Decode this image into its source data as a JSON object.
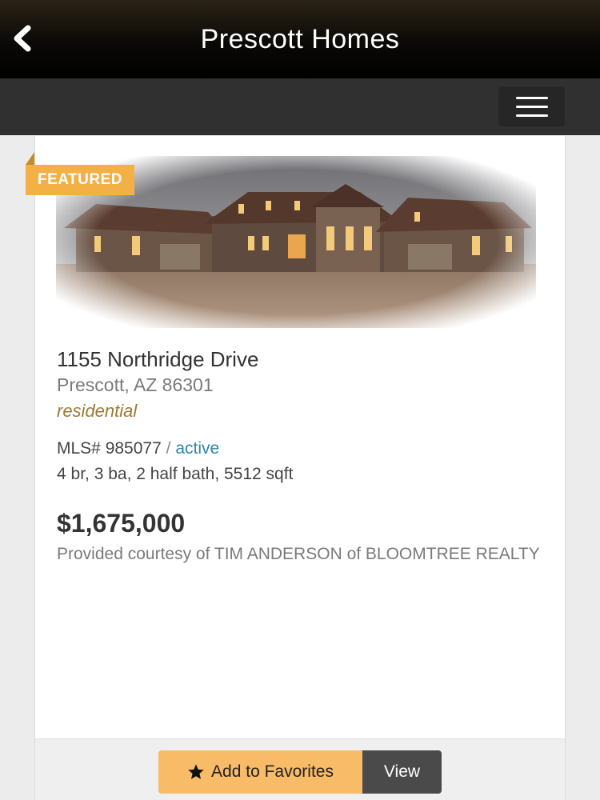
{
  "header": {
    "title": "Prescott Homes",
    "back_icon": "chevron-left-icon",
    "menu_icon": "hamburger-menu-icon",
    "bar_color": "#000000",
    "nav_color": "#303030"
  },
  "listing": {
    "badge": "FEATURED",
    "badge_color": "#f2b045",
    "photo": "house-photo",
    "address": "1155 Northridge Drive",
    "city_line": "Prescott, AZ 86301",
    "property_type": "residential",
    "mls_label": "MLS# 985077",
    "mls_separator": "/",
    "status": "active",
    "status_color": "#2f86a6",
    "specs": "4 br, 3 ba, 2 half bath, 5512 sqft",
    "price": "$1,675,000",
    "courtesy": "Provided courtesy of TIM ANDERSON of BLOOMTREE REALTY"
  },
  "actions": {
    "favorite_icon": "star-icon",
    "favorite_label": "Add to Favorites",
    "favorite_color": "#f8bb67",
    "view_label": "View",
    "view_color": "#4a4a4a"
  }
}
